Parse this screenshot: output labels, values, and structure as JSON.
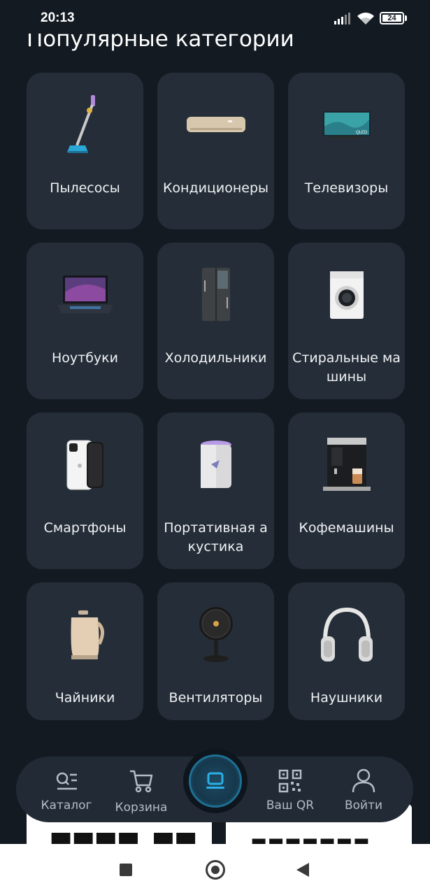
{
  "status_bar": {
    "time": "20:13",
    "battery": "24"
  },
  "section_title": "Популярные категории",
  "categories": [
    {
      "label": "Пылесосы",
      "icon": "vacuum-icon"
    },
    {
      "label": "Кондиционеры",
      "icon": "air-conditioner-icon"
    },
    {
      "label": "Телевизоры",
      "icon": "tv-icon"
    },
    {
      "label": "Ноутбуки",
      "icon": "laptop-icon"
    },
    {
      "label": "Холодильники",
      "icon": "fridge-icon"
    },
    {
      "label": "Стиральные машины",
      "icon": "washing-machine-icon"
    },
    {
      "label": "Смартфоны",
      "icon": "smartphone-icon"
    },
    {
      "label": "Портативная акустика",
      "icon": "speaker-icon"
    },
    {
      "label": "Кофемашины",
      "icon": "coffee-machine-icon"
    },
    {
      "label": "Чайники",
      "icon": "kettle-icon"
    },
    {
      "label": "Вентиляторы",
      "icon": "fan-icon"
    },
    {
      "label": "Наушники",
      "icon": "headphones-icon"
    }
  ],
  "bottom_nav": {
    "catalog": "Каталог",
    "cart": "Корзина",
    "qr": "Ваш QR",
    "login": "Войти"
  },
  "colors": {
    "background": "#131a22",
    "card": "#252e38",
    "nav": "#222b35",
    "accent": "#1f8fc4"
  }
}
